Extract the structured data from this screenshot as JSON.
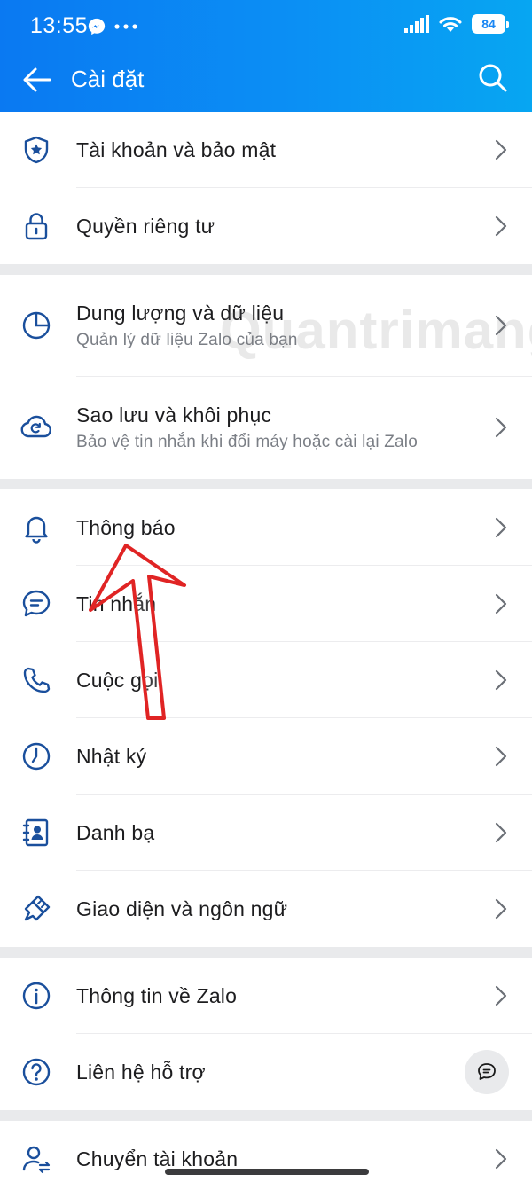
{
  "status_bar": {
    "time": "13:55",
    "battery": "84",
    "icons": [
      "messenger-icon",
      "more-dots-icon",
      "signal-icon",
      "wifi-icon",
      "battery-icon"
    ]
  },
  "header": {
    "title": "Cài đặt",
    "back_icon": "arrow-left-icon",
    "search_icon": "search-icon"
  },
  "watermark": "Quantrimang",
  "groups": [
    {
      "items": [
        {
          "id": "account",
          "label": "Tài khoản và bảo mật",
          "icon": "shield-star-icon"
        },
        {
          "id": "privacy",
          "label": "Quyền riêng tư",
          "icon": "lock-icon"
        }
      ]
    },
    {
      "items": [
        {
          "id": "storage",
          "label": "Dung lượng và dữ liệu",
          "sub": "Quản lý dữ liệu Zalo của bạn",
          "icon": "pie-chart-icon"
        },
        {
          "id": "backup",
          "label": "Sao lưu và khôi phục",
          "sub": "Bảo vệ tin nhắn khi đổi máy hoặc cài lại Zalo",
          "icon": "cloud-sync-icon"
        }
      ]
    },
    {
      "items": [
        {
          "id": "notifications",
          "label": "Thông báo",
          "icon": "bell-icon"
        },
        {
          "id": "messages",
          "label": "Tin nhắn",
          "icon": "chat-bubble-icon"
        },
        {
          "id": "calls",
          "label": "Cuộc gọi",
          "icon": "phone-icon"
        },
        {
          "id": "diary",
          "label": "Nhật ký",
          "icon": "clock-icon"
        },
        {
          "id": "contacts",
          "label": "Danh bạ",
          "icon": "contact-book-icon"
        },
        {
          "id": "appearance",
          "label": "Giao diện và ngôn ngữ",
          "icon": "paint-brush-icon"
        }
      ]
    },
    {
      "items": [
        {
          "id": "about",
          "label": "Thông tin về Zalo",
          "icon": "info-icon"
        },
        {
          "id": "support",
          "label": "Liên hệ hỗ trợ",
          "icon": "help-icon"
        }
      ]
    },
    {
      "items": [
        {
          "id": "switch_account",
          "label": "Chuyển tài khoản",
          "icon": "switch-user-icon"
        }
      ]
    }
  ],
  "colors": {
    "accent": "#0a79f2",
    "icon": "#1a4f9c",
    "annotation_arrow": "#e02424"
  }
}
